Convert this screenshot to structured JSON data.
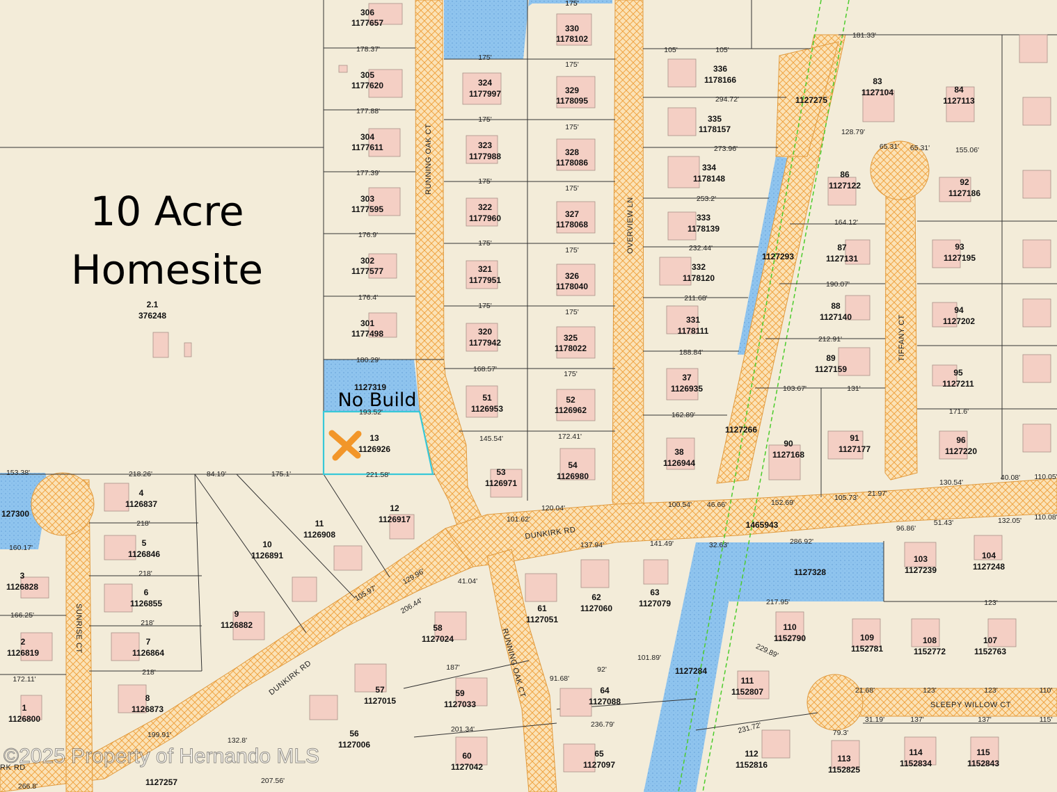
{
  "annotations": {
    "homesite_line1": "10 Acre",
    "homesite_line2": "Homesite",
    "no_build": "No Build",
    "watermark": "©2025 Property of Hernando MLS"
  },
  "roads": {
    "running_oak_ct_north": "RUNNING OAK CT",
    "running_oak_ct_south": "RUNNING OAK CT",
    "overview_ln": "OVERVIEW LN",
    "tiffany_ct": "TIFFANY CT",
    "dunkirk_rd_east": "DUNKIRK RD",
    "dunkirk_rd_west": "DUNKIRK RD",
    "sunrise_ct": "SUNRISE CT",
    "sleepy_willow_ct": "SLEEPY WILLOW CT",
    "rk_rd": "RK RD"
  },
  "parcels": [
    {
      "lot": "306",
      "id": "1177657"
    },
    {
      "lot": "305",
      "id": "1177620"
    },
    {
      "lot": "304",
      "id": "1177611"
    },
    {
      "lot": "303",
      "id": "1177595"
    },
    {
      "lot": "302",
      "id": "1177577"
    },
    {
      "lot": "301",
      "id": "1177498"
    },
    {
      "lot": "",
      "id": "1127319"
    },
    {
      "lot": "13",
      "id": "1126926"
    },
    {
      "lot": "2.1",
      "id": "376248"
    },
    {
      "lot": "330",
      "id": "1178102"
    },
    {
      "lot": "329",
      "id": "1178095"
    },
    {
      "lot": "328",
      "id": "1178086"
    },
    {
      "lot": "327",
      "id": "1178068"
    },
    {
      "lot": "326",
      "id": "1178040"
    },
    {
      "lot": "325",
      "id": "1178022"
    },
    {
      "lot": "324",
      "id": "1177997"
    },
    {
      "lot": "323",
      "id": "1177988"
    },
    {
      "lot": "322",
      "id": "1177960"
    },
    {
      "lot": "321",
      "id": "1177951"
    },
    {
      "lot": "320",
      "id": "1177942"
    },
    {
      "lot": "51",
      "id": "1126953"
    },
    {
      "lot": "52",
      "id": "1126962"
    },
    {
      "lot": "53",
      "id": "1126971"
    },
    {
      "lot": "54",
      "id": "1126980"
    },
    {
      "lot": "336",
      "id": "1178166"
    },
    {
      "lot": "335",
      "id": "1178157"
    },
    {
      "lot": "334",
      "id": "1178148"
    },
    {
      "lot": "333",
      "id": "1178139"
    },
    {
      "lot": "332",
      "id": "1178120"
    },
    {
      "lot": "331",
      "id": "1178111"
    },
    {
      "lot": "37",
      "id": "1126935"
    },
    {
      "lot": "38",
      "id": "1126944"
    },
    {
      "lot": "",
      "id": "1127275"
    },
    {
      "lot": "",
      "id": "1127293"
    },
    {
      "lot": "",
      "id": "1127266"
    },
    {
      "lot": "",
      "id": "1465943"
    },
    {
      "lot": "",
      "id": "1127328"
    },
    {
      "lot": "",
      "id": "1127284"
    },
    {
      "lot": "83",
      "id": "1127104"
    },
    {
      "lot": "84",
      "id": "1127113"
    },
    {
      "lot": "86",
      "id": "1127122"
    },
    {
      "lot": "87",
      "id": "1127131"
    },
    {
      "lot": "88",
      "id": "1127140"
    },
    {
      "lot": "89",
      "id": "1127159"
    },
    {
      "lot": "90",
      "id": "1127168"
    },
    {
      "lot": "91",
      "id": "1127177"
    },
    {
      "lot": "92",
      "id": "1127186"
    },
    {
      "lot": "93",
      "id": "1127195"
    },
    {
      "lot": "94",
      "id": "1127202"
    },
    {
      "lot": "95",
      "id": "1127211"
    },
    {
      "lot": "96",
      "id": "1127220"
    },
    {
      "lot": "4",
      "id": "1126837"
    },
    {
      "lot": "5",
      "id": "1126846"
    },
    {
      "lot": "6",
      "id": "1126855"
    },
    {
      "lot": "7",
      "id": "1126864"
    },
    {
      "lot": "8",
      "id": "1126873"
    },
    {
      "lot": "3",
      "id": "1126828"
    },
    {
      "lot": "2",
      "id": "1126819"
    },
    {
      "lot": "1",
      "id": "1126800"
    },
    {
      "lot": "9",
      "id": "1126882"
    },
    {
      "lot": "10",
      "id": "1126891"
    },
    {
      "lot": "11",
      "id": "1126908"
    },
    {
      "lot": "12",
      "id": "1126917"
    },
    {
      "lot": "58",
      "id": "1127024"
    },
    {
      "lot": "57",
      "id": "1127015"
    },
    {
      "lot": "56",
      "id": "1127006"
    },
    {
      "lot": "59",
      "id": "1127033"
    },
    {
      "lot": "60",
      "id": "1127042"
    },
    {
      "lot": "61",
      "id": "1127051"
    },
    {
      "lot": "62",
      "id": "1127060"
    },
    {
      "lot": "63",
      "id": "1127079"
    },
    {
      "lot": "64",
      "id": "1127088"
    },
    {
      "lot": "65",
      "id": "1127097"
    },
    {
      "lot": "103",
      "id": "1127239"
    },
    {
      "lot": "104",
      "id": "1127248"
    },
    {
      "lot": "110",
      "id": "1152790"
    },
    {
      "lot": "109",
      "id": "1152781"
    },
    {
      "lot": "108",
      "id": "1152772"
    },
    {
      "lot": "107",
      "id": "1152763"
    },
    {
      "lot": "111",
      "id": "1152807"
    },
    {
      "lot": "112",
      "id": "1152816"
    },
    {
      "lot": "113",
      "id": "1152825"
    },
    {
      "lot": "114",
      "id": "1152834"
    },
    {
      "lot": "115",
      "id": "1152843"
    },
    {
      "lot": "",
      "id": "1127257"
    },
    {
      "lot": "",
      "id": "127300"
    }
  ],
  "dimensions": [
    "178.37'",
    "177.88'",
    "177.39'",
    "176.9'",
    "176.4'",
    "180.29'",
    "193.52'",
    "221.58'",
    "175'",
    "175'",
    "175'",
    "175'",
    "175'",
    "175'",
    "175'",
    "175'",
    "175'",
    "175'",
    "175'",
    "175'",
    "175'",
    "168.57'",
    "145.54'",
    "172.41'",
    "105'",
    "105'",
    "294.72'",
    "273.96'",
    "253.2'",
    "232.44'",
    "211.68'",
    "188.84'",
    "162.89'",
    "100.54'",
    "46.66'",
    "120.04'",
    "101.62'",
    "137.94'",
    "141.49'",
    "32.63'",
    "286.92'",
    "152.69'",
    "105.73'",
    "21.97'",
    "51.43'",
    "132.05'",
    "130.54'",
    "40.08'",
    "181.33'",
    "128.79'",
    "65.31'",
    "65.31'",
    "155.06'",
    "164.12'",
    "190.07'",
    "212.91'",
    "103.67'",
    "131'",
    "171.6'",
    "218.26'",
    "84.19'",
    "175.1'",
    "153.38'",
    "218'",
    "218'",
    "218'",
    "218'",
    "166.25'",
    "172.11'",
    "160.17'",
    "129.96'",
    "105.97'",
    "206.44'",
    "41.04'",
    "187'",
    "92'",
    "101.89'",
    "91.68'",
    "236.79'",
    "201.34'",
    "217.95'",
    "229.89'",
    "231.72'",
    "123'",
    "123'",
    "123'",
    "137'",
    "137'",
    "31.19'",
    "79.3'",
    "21.68'",
    "199.91'",
    "132.8'",
    "207.56'",
    "266.8'",
    "110.05'",
    "110.08'",
    "96.86'",
    "110'",
    "115'"
  ]
}
